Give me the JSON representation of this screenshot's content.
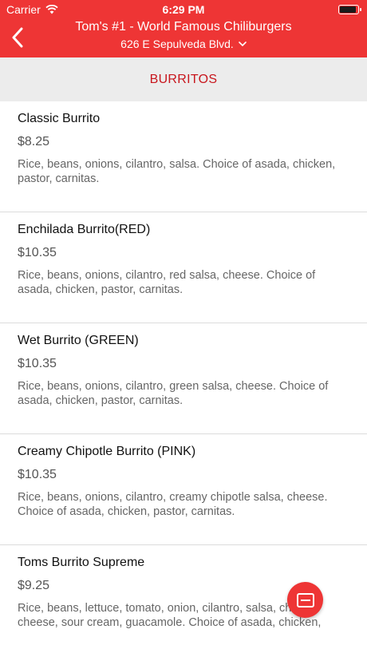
{
  "status_bar": {
    "carrier": "Carrier",
    "time": "6:29 PM",
    "battery_level": 0.9,
    "wifi_icon": "wifi-icon"
  },
  "header": {
    "back_icon": "chevron-left-icon",
    "title": "Tom's #1 - World Famous Chiliburgers",
    "subtitle": "626 E Sepulveda Blvd.",
    "subtitle_icon": "chevron-down-icon",
    "bg_color": "#ee3535"
  },
  "section": {
    "title": "BURRITOS",
    "color": "#c8161d"
  },
  "items": [
    {
      "name": "Classic Burrito",
      "price": "$8.25",
      "desc": "Rice, beans, onions, cilantro, salsa. Choice of asada, chicken, pastor, carnitas."
    },
    {
      "name": "Enchilada Burrito(RED)",
      "price": "$10.35",
      "desc": "Rice, beans, onions, cilantro, red salsa, cheese. Choice of asada, chicken, pastor, carnitas."
    },
    {
      "name": "Wet Burrito (GREEN)",
      "price": "$10.35",
      "desc": "Rice, beans, onions, cilantro, green salsa, cheese. Choice of asada, chicken, pastor, carnitas."
    },
    {
      "name": "Creamy Chipotle Burrito (PINK)",
      "price": "$10.35",
      "desc": "Rice, beans, onions, cilantro, creamy chipotle salsa, cheese. Choice of asada, chicken, pastor, carnitas."
    },
    {
      "name": "Toms Burrito Supreme",
      "price": "$9.25",
      "desc": "Rice, beans, lettuce, tomato, onion, cilantro, salsa, cheddar cheese, sour cream, guacamole. Choice of asada, chicken,"
    }
  ],
  "fab": {
    "icon": "order-icon"
  }
}
